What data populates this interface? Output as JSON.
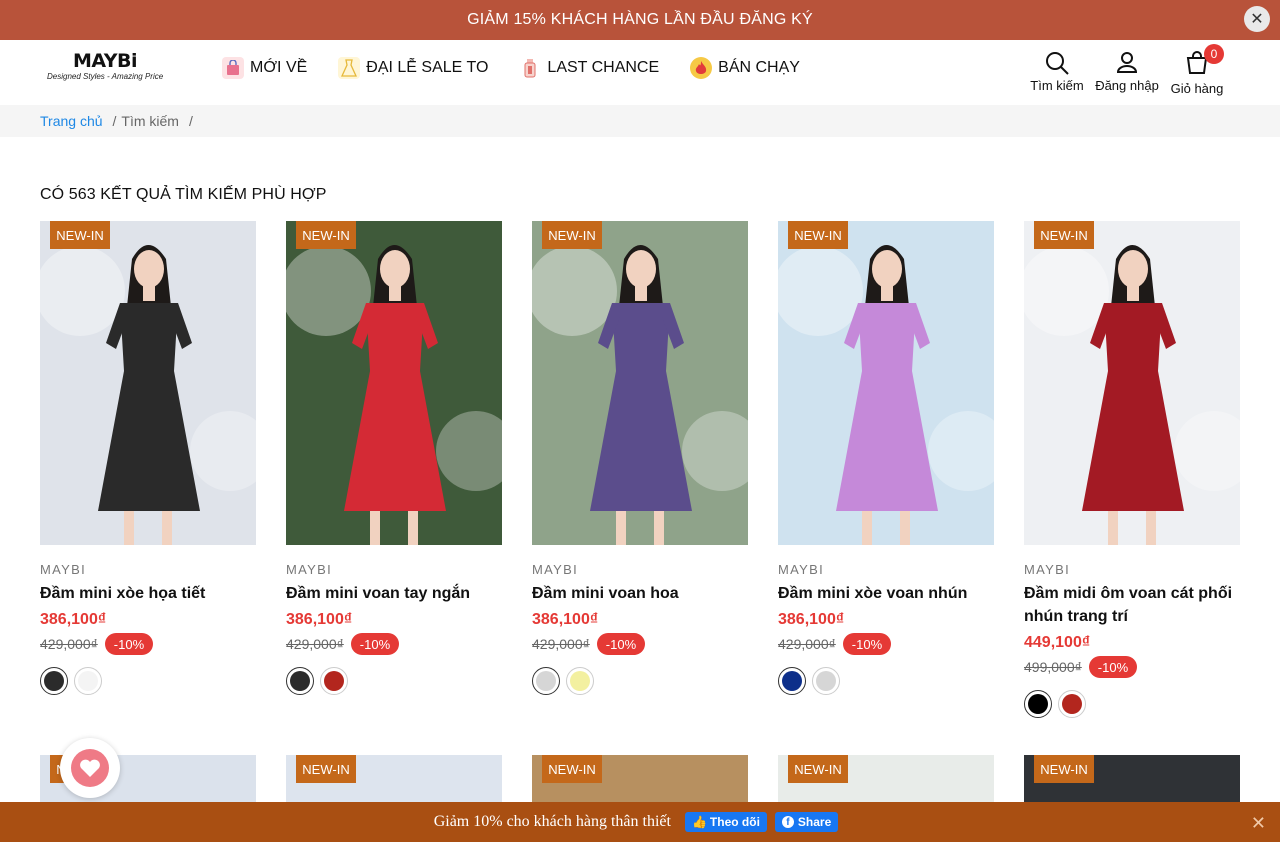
{
  "promo_bar": {
    "text": "GIẢM 15% KHÁCH HÀNG LẦN ĐẦU ĐĂNG KÝ",
    "close": "✕"
  },
  "logo": {
    "name": "MAYBi",
    "tagline": "Designed Styles - Amazing Price"
  },
  "nav": [
    {
      "label": "MỚI VỀ",
      "icon": "shopping-bag-icon"
    },
    {
      "label": "ĐẠI LỄ SALE TO",
      "icon": "dress-icon"
    },
    {
      "label": "LAST CHANCE",
      "icon": "bottle-icon"
    },
    {
      "label": "BÁN CHẠY",
      "icon": "fire-icon"
    }
  ],
  "header_actions": {
    "search": "Tìm kiếm",
    "login": "Đăng nhập",
    "cart": "Giỏ hàng",
    "cart_count": "0"
  },
  "breadcrumb": {
    "home": "Trang chủ",
    "current": "Tìm kiếm",
    "sep": "/"
  },
  "results_title": "CÓ 563 KẾT QUẢ TÌM KIẾM PHÙ HỢP",
  "colors": {
    "accent_red": "#e53935",
    "badge": "#c4681a",
    "promo": "#b8533a",
    "bottom_bar": "#a94f12"
  },
  "products": [
    {
      "badge": "NEW-IN",
      "brand": "MAYBI",
      "name": "Đầm mini xòe họa tiết",
      "price": "386,100₫",
      "old_price": "429,000₫",
      "discount": "-10%",
      "swatches": [
        "#2b2b2b",
        "#f4f4f4"
      ],
      "dress_color": "#2a2a2a",
      "bg": "#dfe3ea"
    },
    {
      "badge": "NEW-IN",
      "brand": "MAYBI",
      "name": "Đầm mini voan tay ngắn",
      "price": "386,100₫",
      "old_price": "429,000₫",
      "discount": "-10%",
      "swatches": [
        "#2b2b2b",
        "#b3261e"
      ],
      "dress_color": "#d42a35",
      "bg": "#3f5a3a"
    },
    {
      "badge": "NEW-IN",
      "brand": "MAYBI",
      "name": "Đầm mini voan hoa",
      "price": "386,100₫",
      "old_price": "429,000₫",
      "discount": "-10%",
      "swatches": [
        "#d6d6d6",
        "#f3f0a0"
      ],
      "dress_color": "#5b4d8c",
      "bg": "#8fa38a"
    },
    {
      "badge": "NEW-IN",
      "brand": "MAYBI",
      "name": "Đầm mini xòe voan nhún",
      "price": "386,100₫",
      "old_price": "429,000₫",
      "discount": "-10%",
      "swatches": [
        "#0d2f8a",
        "#d6d6d6"
      ],
      "dress_color": "#c589d9",
      "bg": "#cfe2ef"
    },
    {
      "badge": "NEW-IN",
      "brand": "MAYBI",
      "name": "Đầm midi ôm voan cát phối nhún trang trí",
      "price": "449,100₫",
      "old_price": "499,000₫",
      "discount": "-10%",
      "swatches": [
        "#000000",
        "#b3261e"
      ],
      "dress_color": "#a31a24",
      "bg": "#eef0f3"
    }
  ],
  "row2_badges": [
    "NEW-IN",
    "NEW-IN",
    "NEW-IN",
    "NEW-IN",
    "NEW-IN"
  ],
  "row2_bg": [
    "#dbe2ec",
    "#dde4ee",
    "#b79060",
    "#e8ece9",
    "#2f3236"
  ],
  "bottom_bar": {
    "text": "Giảm 10% cho khách hàng thân thiết",
    "follow": "Theo dõi",
    "share": "Share",
    "close": "✕"
  }
}
